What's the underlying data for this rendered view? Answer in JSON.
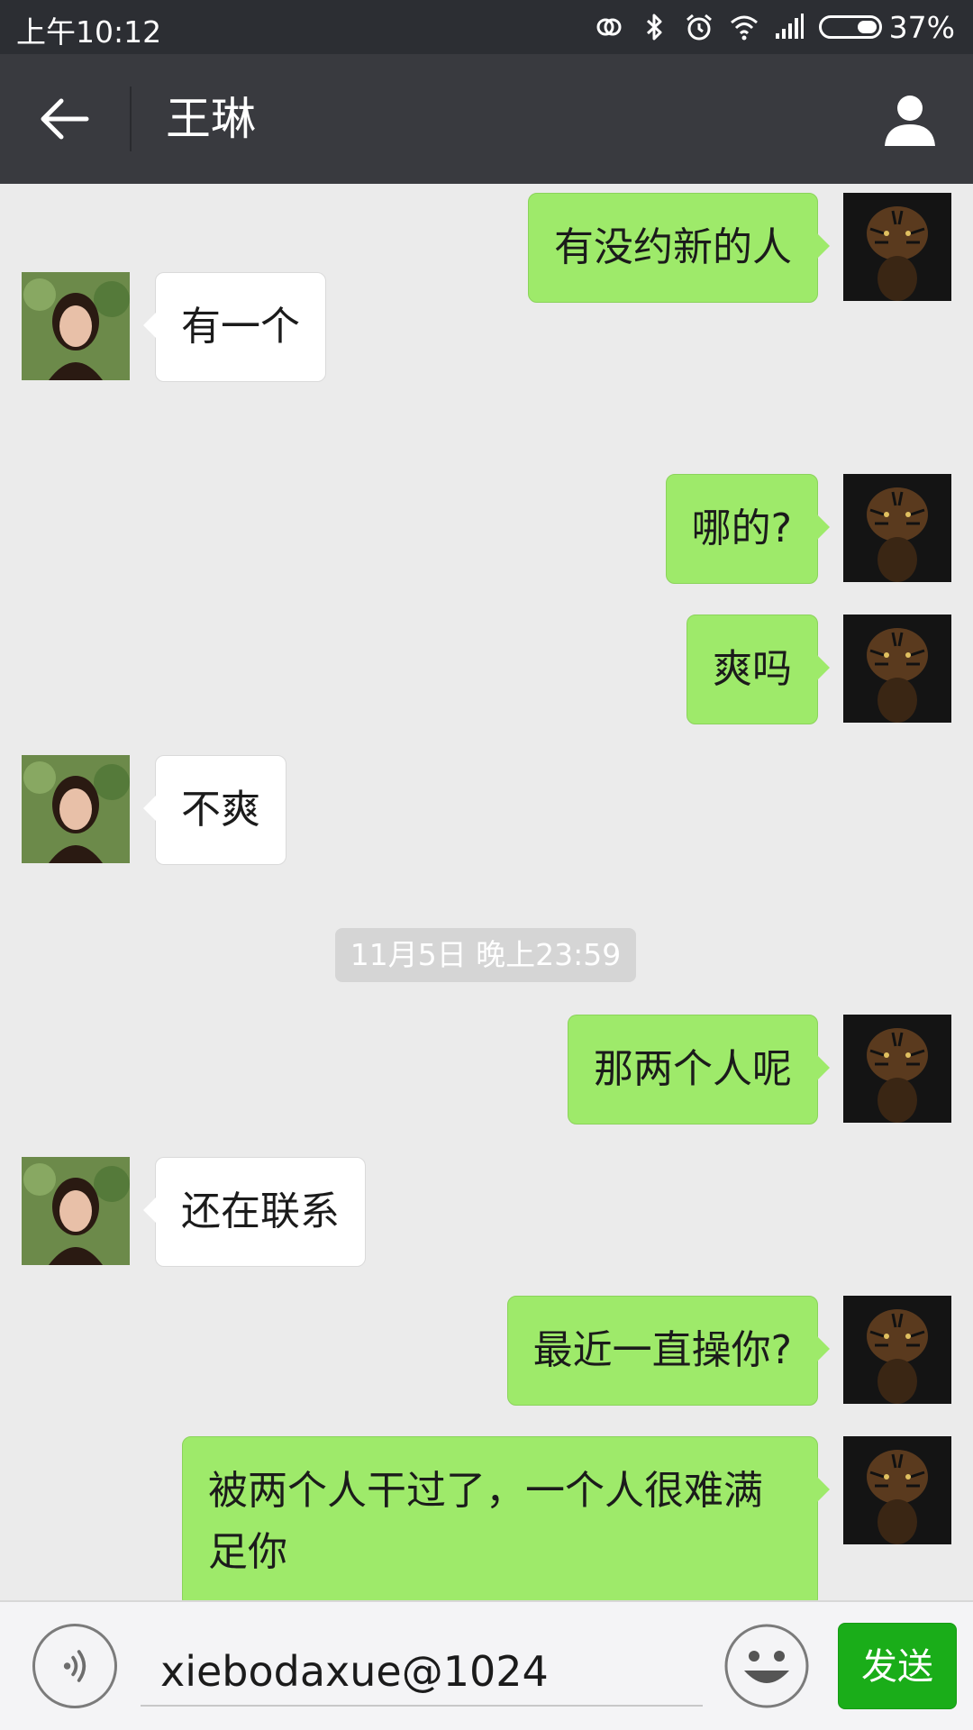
{
  "status_bar": {
    "time": "上午10:12",
    "battery_percent": "37%",
    "battery_level": 0.37,
    "icons": [
      "link-icon",
      "bluetooth-icon",
      "alarm-icon",
      "wifi-icon",
      "signal-icon",
      "battery-icon"
    ]
  },
  "header": {
    "title": "王琳",
    "back_icon": "back-arrow-icon",
    "profile_icon": "person-icon",
    "background": "#393a3f"
  },
  "chat": {
    "messages": [
      {
        "side": "self",
        "text": "有没约新的人"
      },
      {
        "side": "other",
        "text": "有一个"
      },
      {
        "side": "self",
        "text": "哪的?"
      },
      {
        "side": "self",
        "text": "爽吗"
      },
      {
        "side": "other",
        "text": "不爽"
      },
      {
        "type": "timestamp",
        "text": "11月5日 晚上23:59"
      },
      {
        "side": "self",
        "text": "那两个人呢"
      },
      {
        "side": "other",
        "text": "还在联系"
      },
      {
        "side": "self",
        "text": "最近一直操你?"
      },
      {
        "side": "self",
        "text": "被两个人干过了，一个人很难满足你"
      }
    ],
    "self_avatar": "tiger-avatar",
    "other_avatar": "woman-avatar",
    "self_bubble_color": "#9eea6a",
    "other_bubble_color": "#ffffff"
  },
  "input_bar": {
    "value": "xiebodaxue@1024",
    "voice_icon": "voice-icon",
    "emoji_icon": "emoji-icon",
    "send_label": "发送",
    "send_color": "#1aad19"
  }
}
